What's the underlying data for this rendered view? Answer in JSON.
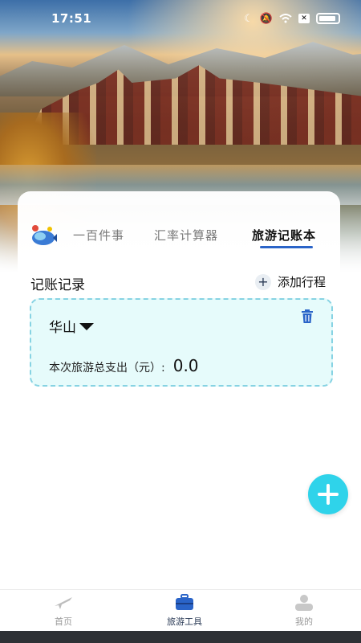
{
  "status_bar": {
    "time": "17:51"
  },
  "tabs": [
    {
      "label": "一百件事",
      "active": false
    },
    {
      "label": "汇率计算器",
      "active": false
    },
    {
      "label": "旅游记账本",
      "active": true
    }
  ],
  "records": {
    "section_title": "记账记录",
    "add_label": "添加行程",
    "items": [
      {
        "title": "华山",
        "expense_label": "本次旅游总支出（元）:",
        "expense_value": "0.0"
      }
    ]
  },
  "bottom_nav": [
    {
      "label": "首页",
      "icon": "plane-icon",
      "active": false
    },
    {
      "label": "旅游工具",
      "icon": "suitcase-icon",
      "active": true
    },
    {
      "label": "我的",
      "icon": "profile-icon",
      "active": false
    }
  ],
  "colors": {
    "accent": "#2a64c8",
    "fab": "#2fd3ea",
    "card_bg": "#e6fbfb",
    "card_border": "#87d3e3",
    "trash": "#2a64c8"
  }
}
